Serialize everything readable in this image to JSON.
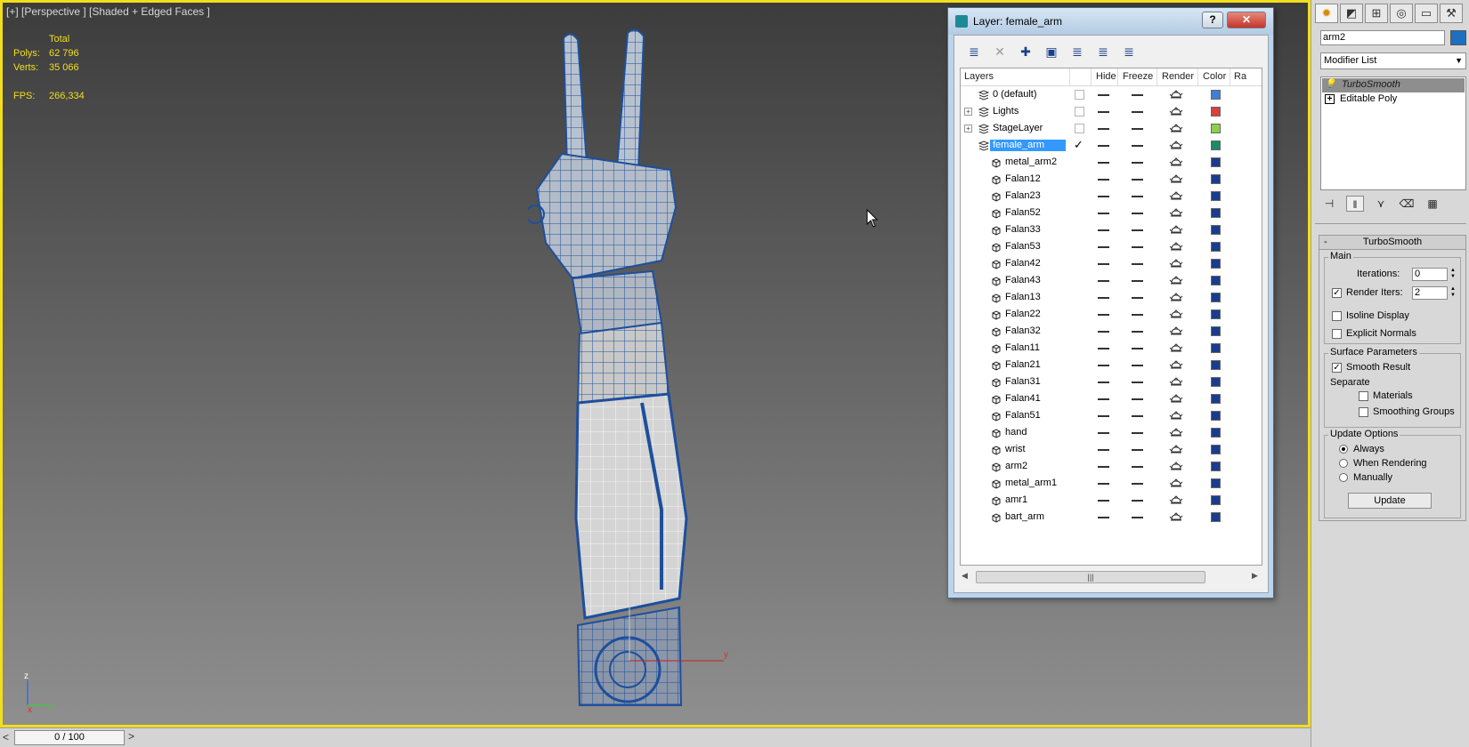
{
  "viewport": {
    "label": "[+] [Perspective ] [Shaded + Edged Faces ]",
    "stats": {
      "header": "Total",
      "polys_label": "Polys:",
      "polys_value": "62 796",
      "verts_label": "Verts:",
      "verts_value": "35 066",
      "fps_label": "FPS:",
      "fps_value": "266,334"
    },
    "axis": {
      "z": "z",
      "x": "x",
      "y": "y"
    },
    "gizmo": {
      "z": "z",
      "y": "y"
    }
  },
  "timeline": {
    "frame": "0 / 100",
    "prev": "<",
    "next": ">"
  },
  "layer_dialog": {
    "title": "Layer: female_arm",
    "help": "?",
    "close": "✕",
    "columns": {
      "layers": "Layers",
      "hide": "Hide",
      "freeze": "Freeze",
      "render": "Render",
      "color": "Color",
      "radiosity": "Ra"
    },
    "rows": [
      {
        "name": "0 (default)",
        "type": "layer",
        "color": "#3f7fd6"
      },
      {
        "name": "Lights",
        "type": "layer",
        "expandable": true,
        "color": "#d94040"
      },
      {
        "name": "StageLayer",
        "type": "layer",
        "expandable": true,
        "color": "#8ccf4a"
      },
      {
        "name": "female_arm",
        "type": "layer",
        "selected": true,
        "current": true,
        "color": "#1e8a6a"
      },
      {
        "name": "metal_arm2",
        "type": "object",
        "color": "#1a3c8c"
      },
      {
        "name": "Falan12",
        "type": "object",
        "color": "#1a3c8c"
      },
      {
        "name": "Falan23",
        "type": "object",
        "color": "#1a3c8c"
      },
      {
        "name": "Falan52",
        "type": "object",
        "color": "#1a3c8c"
      },
      {
        "name": "Falan33",
        "type": "object",
        "color": "#1a3c8c"
      },
      {
        "name": "Falan53",
        "type": "object",
        "color": "#1a3c8c"
      },
      {
        "name": "Falan42",
        "type": "object",
        "color": "#1a3c8c"
      },
      {
        "name": "Falan43",
        "type": "object",
        "color": "#1a3c8c"
      },
      {
        "name": "Falan13",
        "type": "object",
        "color": "#1a3c8c"
      },
      {
        "name": "Falan22",
        "type": "object",
        "color": "#1a3c8c"
      },
      {
        "name": "Falan32",
        "type": "object",
        "color": "#1a3c8c"
      },
      {
        "name": "Falan11",
        "type": "object",
        "color": "#1a3c8c"
      },
      {
        "name": "Falan21",
        "type": "object",
        "color": "#1a3c8c"
      },
      {
        "name": "Falan31",
        "type": "object",
        "color": "#1a3c8c"
      },
      {
        "name": "Falan41",
        "type": "object",
        "color": "#1a3c8c"
      },
      {
        "name": "Falan51",
        "type": "object",
        "color": "#1a3c8c"
      },
      {
        "name": "hand",
        "type": "object",
        "color": "#1a3c8c"
      },
      {
        "name": "wrist",
        "type": "object",
        "color": "#1a3c8c"
      },
      {
        "name": "arm2",
        "type": "object",
        "color": "#1a3c8c"
      },
      {
        "name": "metal_arm1",
        "type": "object",
        "color": "#1a3c8c"
      },
      {
        "name": "amr1",
        "type": "object",
        "color": "#1a3c8c"
      },
      {
        "name": "bart_arm",
        "type": "object",
        "color": "#1a3c8c"
      }
    ],
    "scroll_thumb": "|||"
  },
  "command_panel": {
    "object_name": "arm2",
    "object_color": "#1e6fbf",
    "modifier_list": "Modifier List",
    "stack": [
      {
        "label": "TurboSmooth",
        "selected": true,
        "icon": "bulb-icon"
      },
      {
        "label": "Editable Poly",
        "selected": false,
        "icon": "plus-icon"
      }
    ],
    "turbosmooth": {
      "title": "TurboSmooth",
      "collapse": "-",
      "main_group": "Main",
      "iterations_label": "Iterations:",
      "iterations_value": "0",
      "render_iters_label": "Render Iters:",
      "render_iters_value": "2",
      "render_iters_checked": true,
      "isoline_label": "Isoline Display",
      "explicit_normals_label": "Explicit Normals",
      "surface_group": "Surface Parameters",
      "smooth_result_label": "Smooth Result",
      "separate_label": "Separate",
      "materials_label": "Materials",
      "smoothing_groups_label": "Smoothing Groups",
      "update_group": "Update Options",
      "always_label": "Always",
      "when_rendering_label": "When Rendering",
      "manually_label": "Manually",
      "update_button": "Update"
    }
  }
}
